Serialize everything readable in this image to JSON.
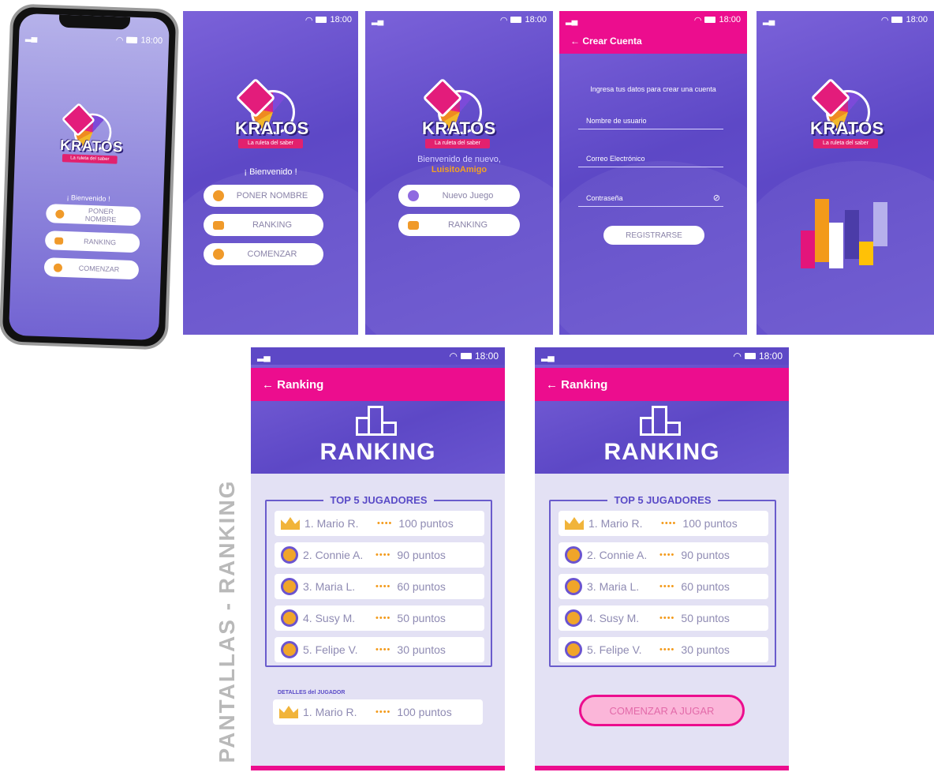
{
  "status": {
    "time": "18:00"
  },
  "logo": {
    "word": "KRATOS",
    "tagline": "La ruleta del saber"
  },
  "phone": {
    "welcome": "¡ Bienvenido !",
    "buttons": [
      "PONER NOMBRE",
      "RANKING",
      "COMENZAR"
    ]
  },
  "screen1": {
    "welcome": "¡ Bienvenido !",
    "buttons": [
      "PONER NOMBRE",
      "RANKING",
      "COMENZAR"
    ]
  },
  "screen2": {
    "welcome_line": "Bienvenido de nuevo,",
    "username": "LuisitoAmigo",
    "buttons": [
      "Nuevo Juego",
      "RANKING"
    ]
  },
  "screen3": {
    "header": "← Crear Cuenta",
    "intro": "Ingresa tus datos para crear una cuenta",
    "fields": [
      "Nombre de usuario",
      "Correo Electrónico",
      "Contraseña"
    ],
    "submit": "REGISTRARSE"
  },
  "chart_colors": [
    "#e3157b",
    "#f39a1a",
    "#ffffff",
    "#4b3ca8",
    "#ffc107",
    "#b6b0ec"
  ],
  "ranking_left": {
    "header": "← Ranking",
    "title": "RANKING",
    "frame_title": "TOP 5 JUGADORES",
    "rows": [
      {
        "name": "1. Mario R.",
        "score": "100 puntos"
      },
      {
        "name": "2. Connie A.",
        "score": "90 puntos"
      },
      {
        "name": "3. Maria L.",
        "score": "60 puntos"
      },
      {
        "name": "4. Susy M.",
        "score": "50 puntos"
      },
      {
        "name": "5. Felipe V.",
        "score": "30 puntos"
      }
    ],
    "details_label": "DETALLES del JUGADOR",
    "detail": {
      "name": "1. Mario R.",
      "score": "100 puntos"
    }
  },
  "ranking_right": {
    "header": "← Ranking",
    "title": "RANKING",
    "frame_title": "TOP 5 JUGADORES",
    "rows": [
      {
        "name": "1. Mario R.",
        "score": "100 puntos"
      },
      {
        "name": "2. Connie A.",
        "score": "90 puntos"
      },
      {
        "name": "3. Maria L.",
        "score": "60 puntos"
      },
      {
        "name": "4. Susy M.",
        "score": "50 puntos"
      },
      {
        "name": "5. Felipe V.",
        "score": "30 puntos"
      }
    ],
    "cta": "COMENZAR A JUGAR"
  },
  "section_label": "PANTALLAS - RANKING"
}
